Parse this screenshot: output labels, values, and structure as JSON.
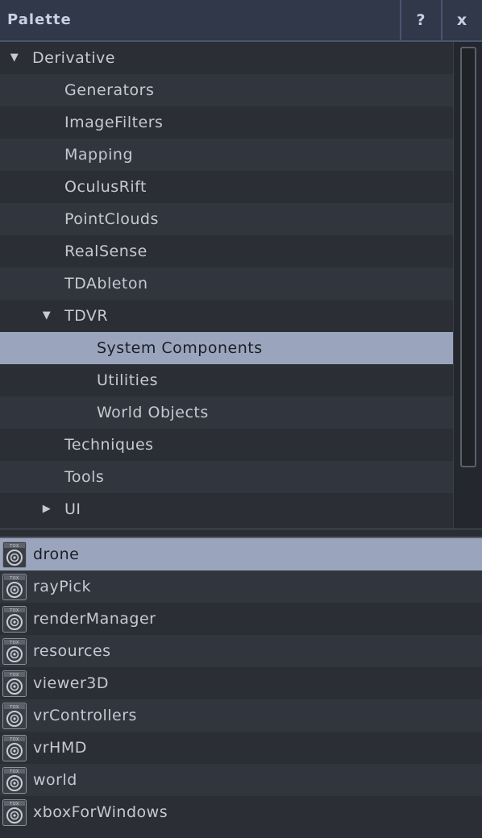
{
  "window": {
    "title": "Palette",
    "help_label": "?",
    "close_label": "x"
  },
  "tree": {
    "items": [
      {
        "label": "Derivative",
        "expander": "expanded",
        "level": 0
      },
      {
        "label": "Generators",
        "level": 1
      },
      {
        "label": "ImageFilters",
        "level": 1
      },
      {
        "label": "Mapping",
        "level": 1
      },
      {
        "label": "OculusRift",
        "level": 1
      },
      {
        "label": "PointClouds",
        "level": 1
      },
      {
        "label": "RealSense",
        "level": 1
      },
      {
        "label": "TDAbleton",
        "level": 1
      },
      {
        "label": "TDVR",
        "expander": "expanded",
        "level": 1
      },
      {
        "label": "System Components",
        "level": 2,
        "selected": true
      },
      {
        "label": "Utilities",
        "level": 2
      },
      {
        "label": "World Objects",
        "level": 2
      },
      {
        "label": "Techniques",
        "level": 1
      },
      {
        "label": "Tools",
        "level": 1
      },
      {
        "label": "UI",
        "expander": "collapsed",
        "level": 1
      }
    ]
  },
  "components": {
    "icon": "tox-component-icon",
    "items": [
      {
        "label": "drone",
        "selected": true
      },
      {
        "label": "rayPick"
      },
      {
        "label": "renderManager"
      },
      {
        "label": "resources"
      },
      {
        "label": "viewer3D"
      },
      {
        "label": "vrControllers"
      },
      {
        "label": "vrHMD"
      },
      {
        "label": "world"
      },
      {
        "label": "xboxForWindows"
      }
    ]
  },
  "colors": {
    "background": "#2b2e35",
    "row_alt": "#31353d",
    "selection": "#9aa5bd",
    "titlebar": "#303849"
  }
}
